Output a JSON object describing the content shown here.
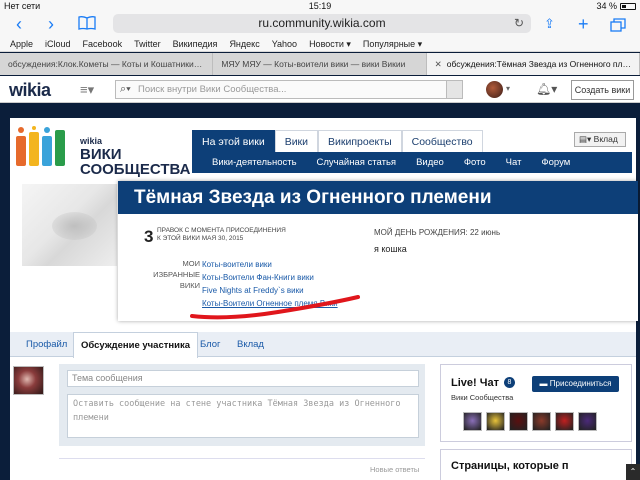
{
  "statusbar": {
    "carrier": "Нет сети",
    "time": "15:19",
    "battery": "34 %",
    "battery_level": 0.34
  },
  "browser": {
    "url": "ru.community.wikia.com",
    "favorites": [
      "Apple",
      "iCloud",
      "Facebook",
      "Twitter",
      "Википедия",
      "Яндекс",
      "Yahoo",
      "Новости ▾",
      "Популярные ▾"
    ],
    "tabs": [
      {
        "title": "обсуждения:Клок.Кометы — Коты и Кошатники В..."
      },
      {
        "title": "МЯУ МЯУ — Коты-воители вики — вики Викии"
      },
      {
        "title": "обсуждения:Тёмная Звезда из Огненного племени"
      }
    ]
  },
  "wikia": {
    "logo": "wikia",
    "search_placeholder": "Поиск внутри Вики Сообщества...",
    "create_wiki": "Создать вики"
  },
  "community": {
    "logo_small": "wikia",
    "logo_line1": "ВИКИ",
    "logo_line2": "СООБЩЕСТВА",
    "nav": [
      "На этой вики",
      "Вики",
      "Википроекты",
      "Сообщество"
    ],
    "subnav": [
      "Вики-деятельность",
      "Случайная статья",
      "Видео",
      "Фото",
      "Чат",
      "Форум"
    ],
    "follow": "Вклад"
  },
  "profile": {
    "name": "Тёмная Звезда из Огненного племени",
    "edit_count": "3",
    "edit_desc_line1": "ПРАВОК С МОМЕНТА ПРИСОЕДИНЕНИЯ",
    "edit_desc_line2": "К ЭТОЙ ВИКИ МАЯ 30, 2015",
    "fav_label_1": "МОИ",
    "fav_label_2": "ИЗБРАННЫЕ",
    "fav_label_3": "ВИКИ",
    "favorites": [
      "Коты-воители вики",
      "Коты-Воители Фан-Книги вики",
      "Five Nights at Freddy`s вики",
      "Коты-Воители Огненное племя Вики"
    ],
    "birthday": "МОЙ ДЕНЬ РОЖДЕНИЯ: 22 июнь",
    "bio": "я кошка"
  },
  "profile_tabs": [
    "Профайл",
    "Обсуждение участника",
    "Блог",
    "Вклад"
  ],
  "composer": {
    "subject_placeholder": "Тема сообщения",
    "body_placeholder": "Оставить сообщение на стене участника Тёмная Звезда из Огненного племени"
  },
  "newer_replies": "Новые ответы",
  "chat": {
    "title": "Live! Чат",
    "count": "8",
    "community": "Вики Сообщества",
    "join": "Присоединиться",
    "user_colors": [
      "#8a6fb8",
      "#e8c33a",
      "#5a1010",
      "#8a3a2a",
      "#c02020",
      "#4b2a7a"
    ]
  },
  "module2_title": "Страницы, которые п",
  "colors": {
    "navy": "#0d3f78",
    "link": "#1a5aa8",
    "annotation": "#e0161c",
    "ios_blue": "#1a7cf5"
  }
}
